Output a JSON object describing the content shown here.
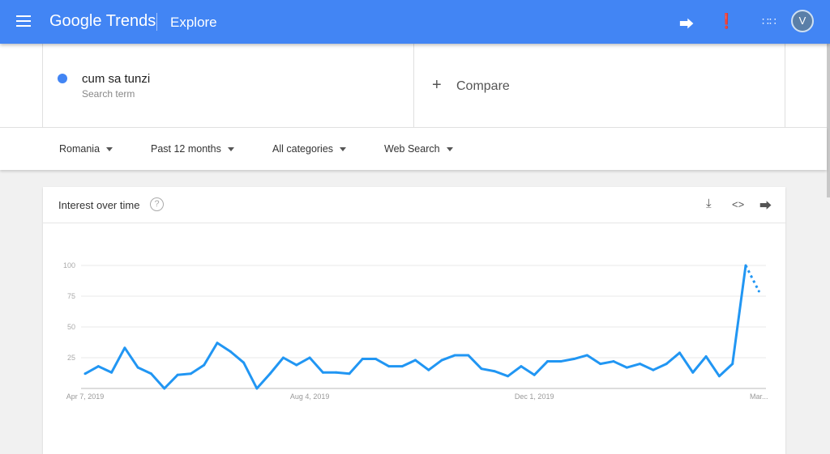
{
  "header": {
    "app_title": "Google Trends",
    "section": "Explore",
    "icons": [
      "menu-icon",
      "share-icon",
      "feedback-icon",
      "apps-icon",
      "avatar"
    ]
  },
  "search": {
    "term": "cum sa tunzi",
    "term_sub": "Search term",
    "term_color": "#4285f4",
    "compare_label": "Compare"
  },
  "filters": {
    "region": "Romania",
    "time": "Past 12 months",
    "category": "All categories",
    "type": "Web Search"
  },
  "card": {
    "title": "Interest over time",
    "icons": [
      "help-icon",
      "download-icon",
      "embed-icon",
      "share-icon"
    ]
  },
  "chart_data": {
    "type": "line",
    "title": "",
    "xlabel": "",
    "ylabel": "",
    "ylim": [
      0,
      100
    ],
    "grid": true,
    "yticks": [
      "100",
      "75",
      "50",
      "25"
    ],
    "xticks": [
      {
        "index": 0,
        "label": "Apr 7, 2019"
      },
      {
        "index": 17,
        "label": "Aug 4, 2019"
      },
      {
        "index": 34,
        "label": "Dec 1, 2019"
      },
      {
        "index": 51,
        "label": "Mar..."
      }
    ],
    "series": [
      {
        "color": "#2196f3",
        "values": [
          12,
          18,
          13,
          33,
          17,
          12,
          0,
          11,
          12,
          19,
          37,
          30,
          21,
          0,
          12,
          25,
          19,
          25,
          13,
          13,
          12,
          24,
          24,
          18,
          18,
          23,
          15,
          23,
          27,
          27,
          16,
          14,
          10,
          18,
          11,
          22,
          22,
          24,
          27,
          20,
          22,
          17,
          20,
          15,
          20,
          29,
          13,
          26,
          10,
          20,
          100,
          79
        ],
        "partial_from_index": 50
      }
    ]
  }
}
